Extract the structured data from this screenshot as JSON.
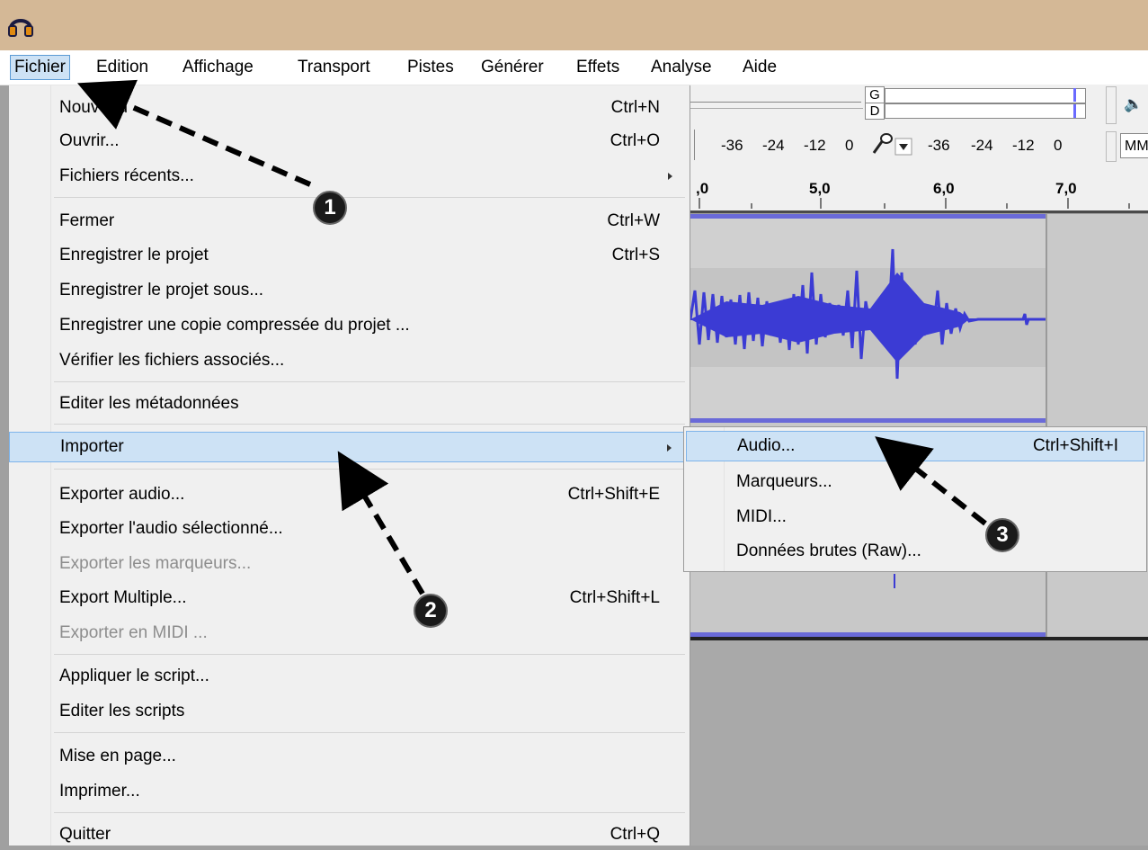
{
  "menubar": {
    "items": [
      "Fichier",
      "Edition",
      "Affichage",
      "Transport",
      "Pistes",
      "Générer",
      "Effets",
      "Analyse",
      "Aide"
    ]
  },
  "file_menu": {
    "items": [
      {
        "label": "Nouveau",
        "shortcut": "Ctrl+N"
      },
      {
        "label": "Ouvrir...",
        "shortcut": "Ctrl+O"
      },
      {
        "label": "Fichiers récents...",
        "shortcut": ""
      },
      {
        "label": "Fermer",
        "shortcut": "Ctrl+W"
      },
      {
        "label": "Enregistrer le projet",
        "shortcut": "Ctrl+S"
      },
      {
        "label": "Enregistrer le projet sous...",
        "shortcut": ""
      },
      {
        "label": "Enregistrer une copie compressée du projet ...",
        "shortcut": ""
      },
      {
        "label": "Vérifier les fichiers associés...",
        "shortcut": ""
      },
      {
        "label": "Editer les métadonnées",
        "shortcut": ""
      },
      {
        "label": "Importer",
        "shortcut": ""
      },
      {
        "label": "Exporter audio...",
        "shortcut": "Ctrl+Shift+E"
      },
      {
        "label": "Exporter l'audio sélectionné...",
        "shortcut": ""
      },
      {
        "label": "Exporter les marqueurs...",
        "shortcut": ""
      },
      {
        "label": "Export Multiple...",
        "shortcut": "Ctrl+Shift+L"
      },
      {
        "label": "Exporter en MIDI ...",
        "shortcut": ""
      },
      {
        "label": "Appliquer le script...",
        "shortcut": ""
      },
      {
        "label": "Editer les scripts",
        "shortcut": ""
      },
      {
        "label": "Mise en page...",
        "shortcut": ""
      },
      {
        "label": "Imprimer...",
        "shortcut": ""
      },
      {
        "label": "Quitter",
        "shortcut": "Ctrl+Q"
      }
    ]
  },
  "import_submenu": {
    "items": [
      {
        "label": "Audio...",
        "shortcut": "Ctrl+Shift+I"
      },
      {
        "label": "Marqueurs...",
        "shortcut": ""
      },
      {
        "label": "MIDI...",
        "shortcut": ""
      },
      {
        "label": "Données brutes (Raw)...",
        "shortcut": ""
      }
    ]
  },
  "meters": {
    "g_label": "G",
    "d_label": "D",
    "scale_rec": [
      "-36",
      "-24",
      "-12",
      "0"
    ],
    "scale_play": [
      "-36",
      "-24",
      "-12",
      "0"
    ],
    "mm_label": "MM"
  },
  "ruler": {
    "labels": [
      ",0",
      "5,0",
      "6,0",
      "7,0"
    ]
  },
  "annotations": [
    "1",
    "2",
    "3"
  ],
  "colors": {
    "waveform": "#3b3bd4",
    "highlight": "#cde2f5",
    "titlebar": "#d4b896"
  }
}
